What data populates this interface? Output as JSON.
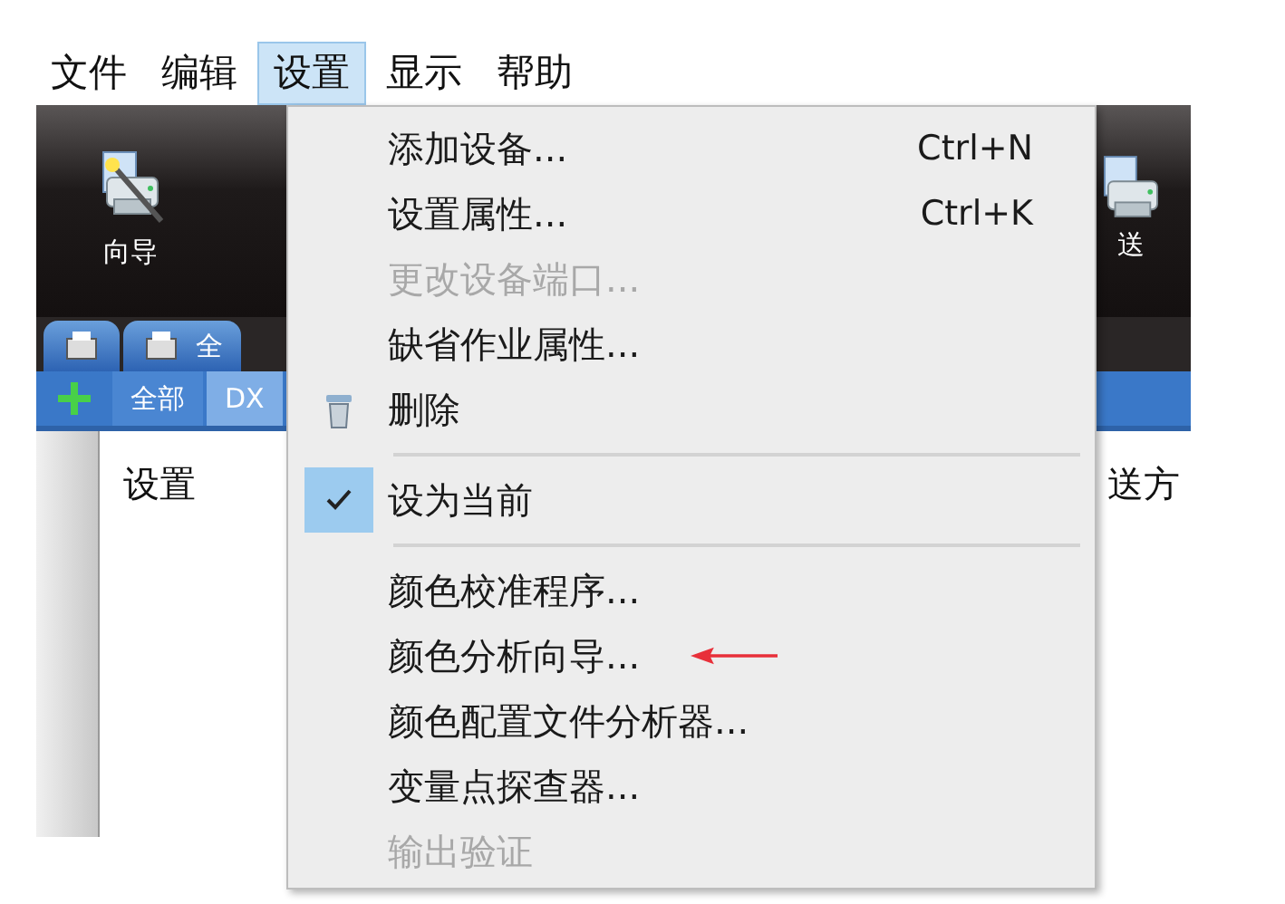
{
  "menu_bar": [
    {
      "label": "文件",
      "selected": false
    },
    {
      "label": "编辑",
      "selected": false
    },
    {
      "label": "设置",
      "selected": true
    },
    {
      "label": "显示",
      "selected": false
    },
    {
      "label": "帮助",
      "selected": false
    }
  ],
  "toolbar": {
    "buttons": [
      {
        "label": "向导"
      },
      {
        "label": "送"
      }
    ]
  },
  "device_tabs": [
    {
      "kind": "icon"
    },
    {
      "kind": "labeled",
      "label": "全"
    }
  ],
  "filter_tabs": [
    {
      "label": "全部",
      "selected": false
    },
    {
      "label": "DX",
      "selected": true
    }
  ],
  "list_columns": [
    {
      "label": "设置"
    },
    {
      "label": "送方"
    }
  ],
  "dropdown": {
    "items": [
      {
        "kind": "plain",
        "label": "添加设备...",
        "shortcut": "Ctrl+N",
        "disabled": false,
        "checked": false,
        "annotated": false
      },
      {
        "kind": "plain",
        "label": "设置属性...",
        "shortcut": "Ctrl+K",
        "disabled": false,
        "checked": false,
        "annotated": false
      },
      {
        "kind": "plain",
        "label": "更改设备端口...",
        "disabled": true,
        "checked": false,
        "annotated": false
      },
      {
        "kind": "plain",
        "label": "缺省作业属性...",
        "disabled": false,
        "checked": false,
        "annotated": false
      },
      {
        "kind": "iconed",
        "label": "删除",
        "disabled": false,
        "checked": false,
        "annotated": false
      },
      {
        "kind": "separator"
      },
      {
        "kind": "plain",
        "label": "设为当前",
        "disabled": false,
        "checked": true,
        "annotated": false
      },
      {
        "kind": "separator"
      },
      {
        "kind": "plain",
        "label": "颜色校准程序...",
        "disabled": false,
        "checked": false,
        "annotated": false
      },
      {
        "kind": "plain",
        "label": "颜色分析向导...",
        "disabled": false,
        "checked": false,
        "annotated": true
      },
      {
        "kind": "plain",
        "label": "颜色配置文件分析器...",
        "disabled": false,
        "checked": false,
        "annotated": false
      },
      {
        "kind": "plain",
        "label": "变量点探查器...",
        "disabled": false,
        "checked": false,
        "annotated": false
      },
      {
        "kind": "plain",
        "label": "输出验证",
        "disabled": true,
        "checked": false,
        "annotated": false
      }
    ]
  }
}
